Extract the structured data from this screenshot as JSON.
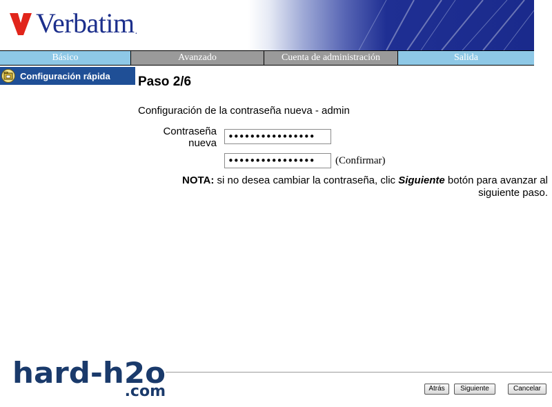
{
  "header": {
    "brand": "Verbatim",
    "brand_color": "#1c2f8c",
    "logo_mark_color": "#e1251b"
  },
  "nav": {
    "tabs": [
      {
        "label": "Básico",
        "state": "inactive-blue"
      },
      {
        "label": "Avanzado",
        "state": "active-gray"
      },
      {
        "label": "Cuenta de administración",
        "state": "active-gray"
      },
      {
        "label": "Salida",
        "state": "inactive-blue"
      }
    ],
    "colors": {
      "blue": "#8ec8e6",
      "gray": "#9a9a9a"
    }
  },
  "sidebar": {
    "items": [
      {
        "label": "Configuración rápida",
        "icon": "quick-setup-folder-icon"
      }
    ],
    "color": "#1f4f96"
  },
  "main": {
    "step_title": "Paso 2/6",
    "section_heading": "Configuración de la contraseña nueva - admin",
    "password_label": "Contraseña nueva",
    "password_value": "••••••••••••••••",
    "confirm_value": "••••••••••••••••",
    "confirm_label": "(Confirmar)",
    "note": {
      "prefix": "NOTA:",
      "text1": " si no desea cambiar la contraseña, clic ",
      "emphasis": "Siguiente",
      "text2": " botón para avanzar al siguiente paso."
    }
  },
  "footer": {
    "buttons": {
      "back": "Atrás",
      "next": "Siguiente",
      "cancel": "Cancelar"
    }
  },
  "watermark": {
    "line1": "hard-h2o",
    "line2": ".com",
    "color": "#1a3a6b"
  }
}
